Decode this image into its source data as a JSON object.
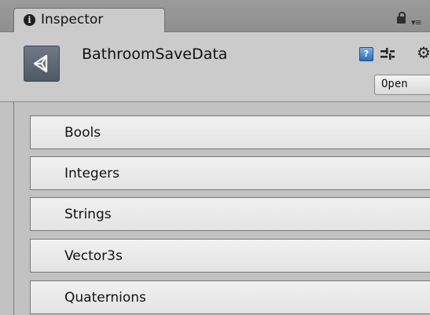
{
  "tab": {
    "label": "Inspector"
  },
  "asset": {
    "name": "BathroomSaveData"
  },
  "header": {
    "help_glyph": "?",
    "open_label": "Open"
  },
  "foldouts": [
    {
      "label": "Bools"
    },
    {
      "label": "Integers"
    },
    {
      "label": "Strings"
    },
    {
      "label": "Vector3s"
    },
    {
      "label": "Quaternions"
    }
  ],
  "colors": {
    "panel_bg": "#c2c2c2",
    "tabstrip_bg": "#9b9b9b",
    "header_bg": "#cbcbcb",
    "foldout_bg": "#ececec"
  },
  "icons": {
    "tab": "info-icon",
    "asset": "unity-asset-icon",
    "help": "help-icon",
    "presets": "presets-icon",
    "settings": "gear-icon",
    "lock": "lock-icon",
    "menu": "tab-menu-icon"
  }
}
